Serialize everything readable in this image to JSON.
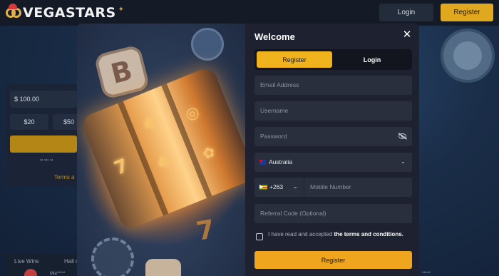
{
  "header": {
    "logo_text": "VEGASTARS",
    "login_label": "Login",
    "register_label": "Register"
  },
  "background": {
    "amount_value": "$  100.00",
    "chip_1": "$20",
    "chip_2": "$50",
    "terms_text": "Terms a",
    "tabs": [
      "Live Wins",
      "Hall o"
    ],
    "left_user": "Mia*****",
    "right_user": "*****"
  },
  "modal": {
    "title": "Welcome",
    "tabs": [
      {
        "label": "Register",
        "active": true
      },
      {
        "label": "Login",
        "active": false
      }
    ],
    "email_placeholder": "Email Address",
    "username_placeholder": "Username",
    "password_placeholder": "Password",
    "country_value": "Australia",
    "phone_code": "+263",
    "mobile_placeholder": "Mobile Number",
    "referral_placeholder": "Referral Code (Optional)",
    "agree_text": "I have read and accepted",
    "agree_link": "the terms and conditions.",
    "submit_label": "Register"
  },
  "colors": {
    "accent": "#f0b31e",
    "modal_bg": "#1e2230",
    "field_bg": "#2a2f3e"
  },
  "icons": {
    "close": "close-icon",
    "password_toggle": "eye-slash-icon",
    "country_flag": "australia-flag-icon",
    "phone_flag": "zimbabwe-flag-icon",
    "dropdown": "chevron-down-icon"
  }
}
